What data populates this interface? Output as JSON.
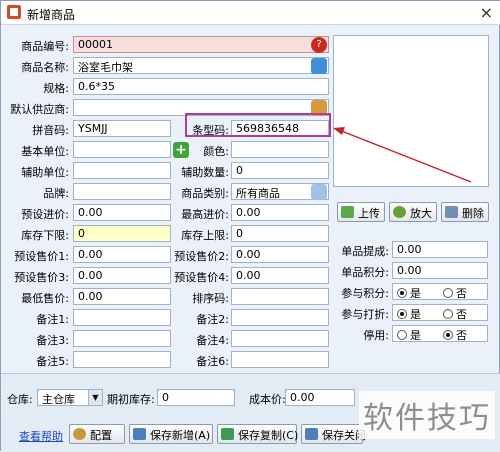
{
  "window": {
    "title": "新增商品",
    "close_glyph": "×"
  },
  "fields": {
    "code": {
      "label": "商品编号:",
      "value": "00001"
    },
    "name": {
      "label": "商品名称:",
      "value": "浴室毛巾架"
    },
    "spec": {
      "label": "规格:",
      "value": "0.6*35"
    },
    "supplier": {
      "label": "默认供应商:",
      "value": ""
    },
    "pinyin": {
      "label": "拼音码:",
      "value": "YSMJJ"
    },
    "barcode": {
      "label": "条型码:",
      "value": "569836548"
    },
    "base_unit": {
      "label": "基本单位:",
      "value": ""
    },
    "color": {
      "label": "颜色:",
      "value": ""
    },
    "aux_unit": {
      "label": "辅助单位:",
      "value": ""
    },
    "aux_qty": {
      "label": "辅助数量:",
      "value": "0"
    },
    "brand": {
      "label": "品牌:",
      "value": ""
    },
    "category": {
      "label": "商品类别:",
      "value": "所有商品"
    },
    "preset_cost": {
      "label": "预设进价:",
      "value": "0.00"
    },
    "max_cost": {
      "label": "最高进价:",
      "value": "0.00"
    },
    "stock_min": {
      "label": "库存下限:",
      "value": "0"
    },
    "stock_max": {
      "label": "库存上限:",
      "value": "0"
    },
    "price1": {
      "label": "预设售价1:",
      "value": "0.00"
    },
    "price2": {
      "label": "预设售价2:",
      "value": "0.00"
    },
    "price3": {
      "label": "预设售价3:",
      "value": "0.00"
    },
    "price4": {
      "label": "预设售价4:",
      "value": "0.00"
    },
    "min_price": {
      "label": "最低售价:",
      "value": "0.00"
    },
    "sort_code": {
      "label": "排序码:",
      "value": ""
    },
    "note1": {
      "label": "备注1:",
      "value": ""
    },
    "note2": {
      "label": "备注2:",
      "value": ""
    },
    "note3": {
      "label": "备注3:",
      "value": ""
    },
    "note4": {
      "label": "备注4:",
      "value": ""
    },
    "note5": {
      "label": "备注5:",
      "value": ""
    },
    "note6": {
      "label": "备注6:",
      "value": ""
    }
  },
  "image_buttons": {
    "upload": "上传",
    "zoom": "放大",
    "delete": "删除"
  },
  "right": {
    "commission": {
      "label": "单品提成:",
      "value": "0.00"
    },
    "points": {
      "label": "单品积分:",
      "value": "0.00"
    },
    "join_points": {
      "label": "参与积分:",
      "yes": "是",
      "no": "否",
      "selected": "yes"
    },
    "join_discount": {
      "label": "参与打折:",
      "yes": "是",
      "no": "否",
      "selected": "yes"
    },
    "disabled": {
      "label": "停用:",
      "yes": "是",
      "no": "否",
      "selected": "no"
    }
  },
  "bottom": {
    "warehouse_label": "仓库:",
    "warehouse_value": "主仓库",
    "opening_stock_label": "期初库存:",
    "opening_stock_value": "0",
    "cost_label": "成本价:",
    "cost_value": "0.00",
    "help": "查看帮助",
    "config": "配置",
    "save_new": "保存新增(A)",
    "save_copy": "保存复制(C)",
    "save_close": "保存关闭"
  },
  "watermark": "软件技巧",
  "colors": {
    "highlight": "#b23a9e",
    "arrow": "#c0282d"
  }
}
